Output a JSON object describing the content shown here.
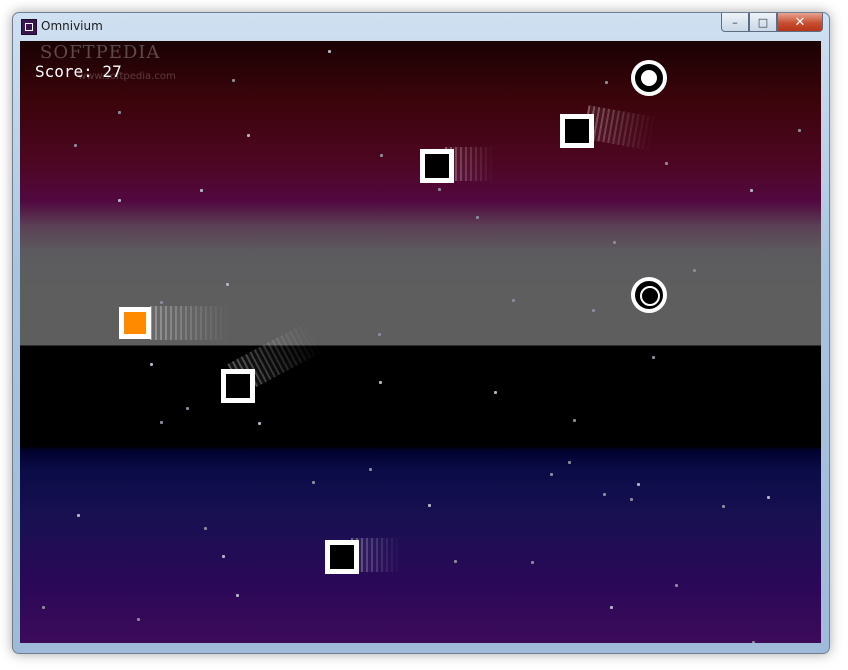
{
  "window": {
    "title": "Omnivium",
    "min_label": "–",
    "max_label": "□",
    "close_label": "✕"
  },
  "watermark": {
    "text": "SOFTPEDIA",
    "sub": "www.softpedia.com"
  },
  "hud": {
    "score": "Score: 27"
  },
  "colors": {
    "player_fill": "#ff8a00",
    "enemy_outline": "#ffffff",
    "sky_top": "#1a0203",
    "horizon": "#5e5e5e",
    "ground": "#000000",
    "space_bottom": "#3d0a5a"
  },
  "icons": {
    "app": "omnivium-app-icon",
    "minimize": "minimize-icon",
    "maximize": "maximize-icon",
    "close": "close-icon"
  }
}
